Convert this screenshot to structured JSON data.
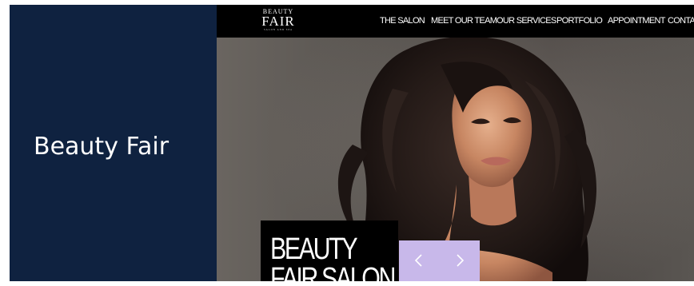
{
  "sidebar": {
    "title": "Beauty Fair"
  },
  "site": {
    "logo": {
      "top": "BEAUTY",
      "main": "FAIR",
      "sub": "SALON AND SPA"
    },
    "nav": [
      {
        "label": "THE SALON"
      },
      {
        "label": "MEET OUR TEAM"
      },
      {
        "label": "OUR SERVICES"
      },
      {
        "label": "PORTFOLIO"
      },
      {
        "label": "APPOINTMENT"
      },
      {
        "label": "CONTACT"
      }
    ],
    "hero": {
      "caption_line1": "BEAUTY",
      "caption_line2": "FAIR SALON",
      "prev_icon": "chevron-left-icon",
      "next_icon": "chevron-right-icon"
    }
  },
  "colors": {
    "sidebar_bg": "#0f2240",
    "nav_bg": "#000000",
    "slider_ctrl_bg": "#c8b8ea"
  }
}
